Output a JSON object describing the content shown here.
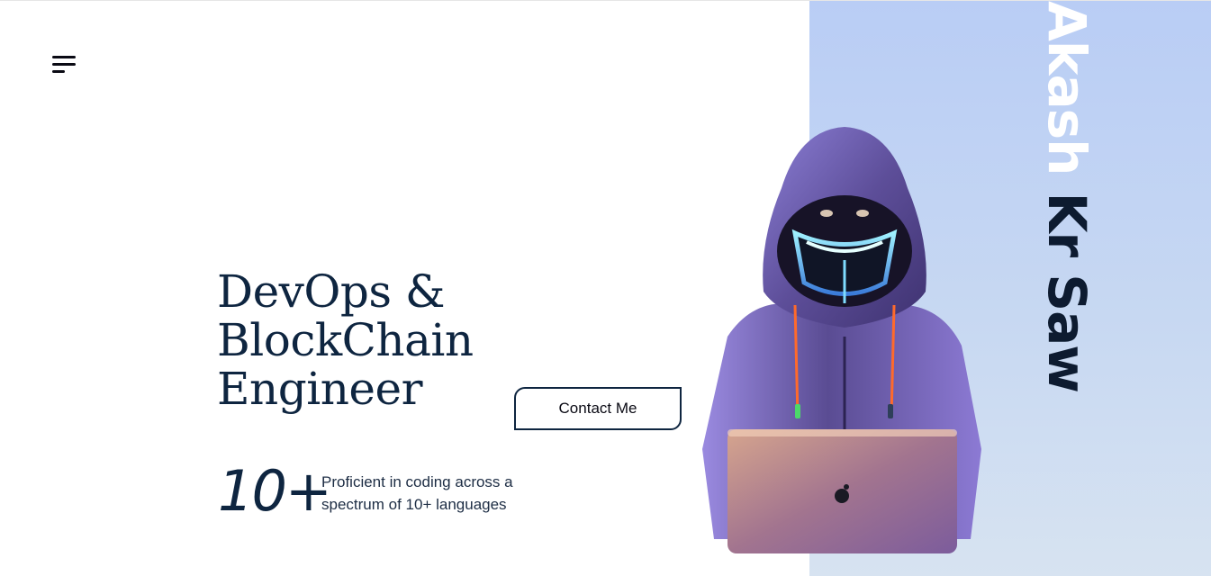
{
  "header": {
    "menu_icon": "hamburger-menu-icon"
  },
  "side": {
    "name_first": "Akash",
    "name_rest": " Kr Saw"
  },
  "hero": {
    "title_line1": "DevOps & BlockChain",
    "title_line2": "Engineer",
    "contact_label": "Contact Me",
    "stat_number": "10+",
    "stat_description": "Proficient in coding across a spectrum of 10+ languages",
    "image_subject": "hooded-hacker-with-laptop-illustration"
  },
  "colors": {
    "accent_panel": "#b9cdf5",
    "text_dark": "#0e2540",
    "hoodie": "#6b5aa8",
    "laptop": "#c48a8a"
  }
}
